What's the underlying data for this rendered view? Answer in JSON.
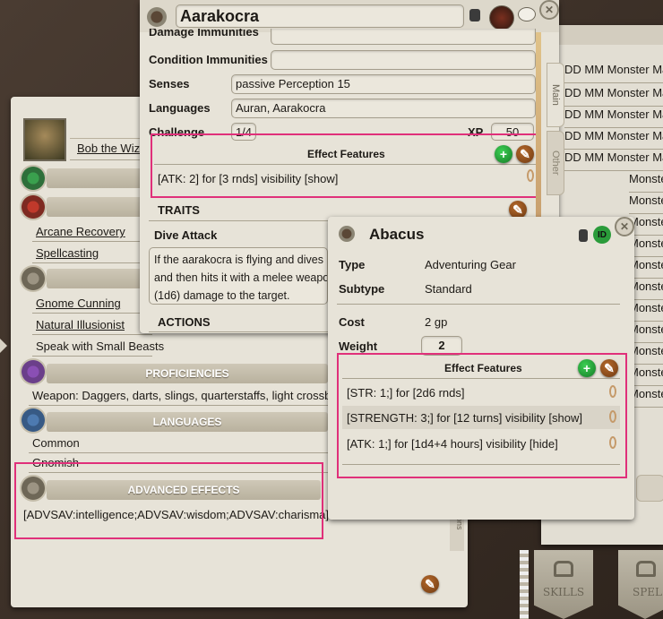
{
  "char_sheet": {
    "name": "Bob the Wizard",
    "features": [
      "Arcane Recovery",
      "Spellcasting"
    ],
    "traits": [
      "Gnome Cunning",
      "Natural Illusionist",
      "Speak with Small Beasts"
    ],
    "proficiencies_header": "PROFICIENCIES",
    "proficiency_text": "Weapon: Daggers, darts, slings, quarterstaffs, light crossbows",
    "languages_header": "LANGUAGES",
    "languages": [
      "Common",
      "Gnomish"
    ],
    "advanced_header": "ADVANCED EFFECTS",
    "advanced_text": "[ADVSAV:intelligence;ADVSAV:wisdom;ADVSAV:charisma]"
  },
  "npc": {
    "title": "Aarakocra",
    "partial_label": "Damage Immunities",
    "condition_immunities_label": "Condition Immunities",
    "senses_label": "Senses",
    "senses_value": "passive Perception 15",
    "languages_label": "Languages",
    "languages_value": "Auran, Aarakocra",
    "challenge_label": "Challenge",
    "challenge_value": "1/4",
    "xp_label": "XP",
    "xp_value": "50",
    "effect_features_header": "Effect Features",
    "effect_text": "[ATK: 2] for [3 rnds] visibility [show]",
    "traits_header": "TRAITS",
    "trait_name": "Dive Attack",
    "trait_desc_1": "If the aarakocra is flying and dives at",
    "trait_desc_2": "and then hits it with a melee weapo",
    "trait_desc_3": "(1d6) damage to the target.",
    "actions_header": "ACTIONS",
    "tab_main": "Main",
    "tab_other": "Other"
  },
  "list_panel": {
    "items": [
      "DD MM Monster Ma",
      "DD MM Monster Ma",
      "DD MM Monster Ma",
      "DD MM Monster Ma",
      "DD MM Monster Ma",
      "Monster Ma",
      "Monster Ma",
      "Monster Ma",
      "Monster Ma",
      "Monster Ma",
      "Monster Ma",
      "Monster Ma",
      "Monster Ma",
      "Monster Ma",
      "Monster Ma",
      "Monster Ma"
    ]
  },
  "item": {
    "title": "Abacus",
    "type_label": "Type",
    "type_value": "Adventuring Gear",
    "subtype_label": "Subtype",
    "subtype_value": "Standard",
    "cost_label": "Cost",
    "cost_value": "2 gp",
    "weight_label": "Weight",
    "weight_value": "2",
    "effect_features_header": "Effect Features",
    "effects": [
      "[STR: 1;] for [2d6 rnds]",
      "[STRENGTH: 3;] for [12 turns] visibility [show]",
      "[ATK: 1;] for [1d4+4 hours] visibility [hide]"
    ]
  },
  "bottom": {
    "skills_label": "SKILLS",
    "spells_label": "SPEL",
    "side_tab": "ions"
  },
  "colors": {
    "highlight": "#e0307a",
    "parchment": "#e7e3d8",
    "green_button": "#2a9b3a",
    "brown_button": "#8b4a1c"
  }
}
